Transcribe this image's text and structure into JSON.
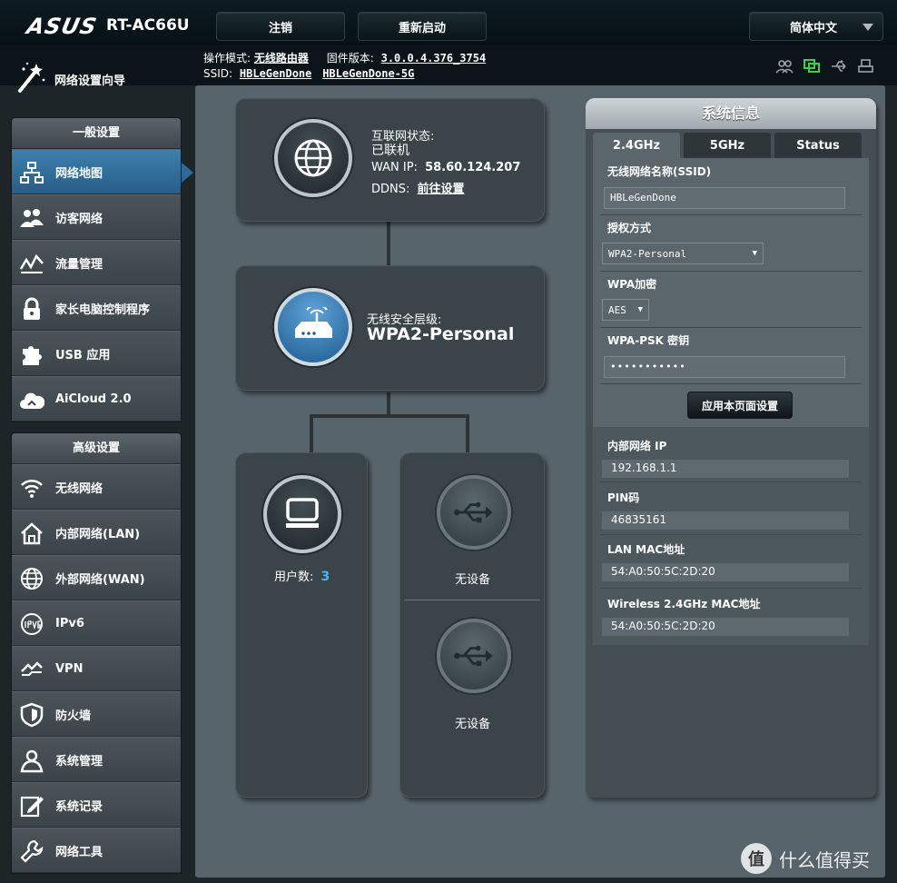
{
  "header": {
    "brand": "ASUS",
    "model": "RT-AC66U",
    "logout_label": "注销",
    "reboot_label": "重新启动",
    "language": "简体中文"
  },
  "subheader": {
    "wizard_label": "网络设置向导",
    "mode_label": "操作模式:",
    "mode_value": "无线路由器",
    "firmware_label": "固件版本:",
    "firmware_value": "3.0.0.4.376_3754",
    "ssid_label": "SSID:",
    "ssid_24": "HBLeGenDone",
    "ssid_5": "HBLeGenDone-5G"
  },
  "sidebar": {
    "general_title": "一般设置",
    "general_items": [
      {
        "label": "网络地图",
        "icon": "network-map-icon"
      },
      {
        "label": "访客网络",
        "icon": "guest-network-icon"
      },
      {
        "label": "流量管理",
        "icon": "traffic-icon"
      },
      {
        "label": "家长电脑控制程序",
        "icon": "lock-icon"
      },
      {
        "label": "USB 应用",
        "icon": "puzzle-icon"
      },
      {
        "label": "AiCloud 2.0",
        "icon": "cloud-icon"
      }
    ],
    "advanced_title": "高级设置",
    "advanced_items": [
      {
        "label": "无线网络",
        "icon": "wifi-icon"
      },
      {
        "label": "内部网络(LAN)",
        "icon": "home-icon"
      },
      {
        "label": "外部网络(WAN)",
        "icon": "globe-icon"
      },
      {
        "label": "IPv6",
        "icon": "ipv6-icon"
      },
      {
        "label": "VPN",
        "icon": "vpn-icon"
      },
      {
        "label": "防火墙",
        "icon": "shield-icon"
      },
      {
        "label": "系统管理",
        "icon": "user-admin-icon"
      },
      {
        "label": "系统记录",
        "icon": "log-icon"
      },
      {
        "label": "网络工具",
        "icon": "wrench-icon"
      }
    ]
  },
  "map": {
    "internet_status_label": "互联网状态:",
    "internet_status": "已联机",
    "wan_ip_label": "WAN IP:",
    "wan_ip": "58.60.124.207",
    "ddns_label": "DDNS:",
    "ddns_link": "前往设置",
    "security_label": "无线安全层级:",
    "security_value": "WPA2-Personal",
    "clients_label": "用户数:",
    "clients_count": "3",
    "usb1_status": "无设备",
    "usb2_status": "无设备"
  },
  "sysinfo": {
    "title": "系统信息",
    "tabs": [
      "2.4GHz",
      "5GHz",
      "Status"
    ],
    "ssid_label": "无线网络名称(SSID)",
    "ssid_value": "HBLeGenDone",
    "auth_label": "授权方式",
    "auth_value": "WPA2-Personal",
    "encrypt_label": "WPA加密",
    "encrypt_value": "AES",
    "psk_label": "WPA-PSK 密钥",
    "psk_value": "•••••••••••",
    "apply_label": "应用本页面设置",
    "lan_ip_label": "内部网络 IP",
    "lan_ip": "192.168.1.1",
    "pin_label": "PIN码",
    "pin": "46835161",
    "lan_mac_label": "LAN MAC地址",
    "lan_mac": "54:A0:50:5C:2D:20",
    "wl_mac_label": "Wireless 2.4GHz MAC地址",
    "wl_mac": "54:A0:50:5C:2D:20"
  },
  "watermark": {
    "badge": "值",
    "text": "什么值得买"
  },
  "colors": {
    "active_menu": "#2d6a98",
    "accent_green": "#39d243",
    "background": "#1d2528"
  }
}
